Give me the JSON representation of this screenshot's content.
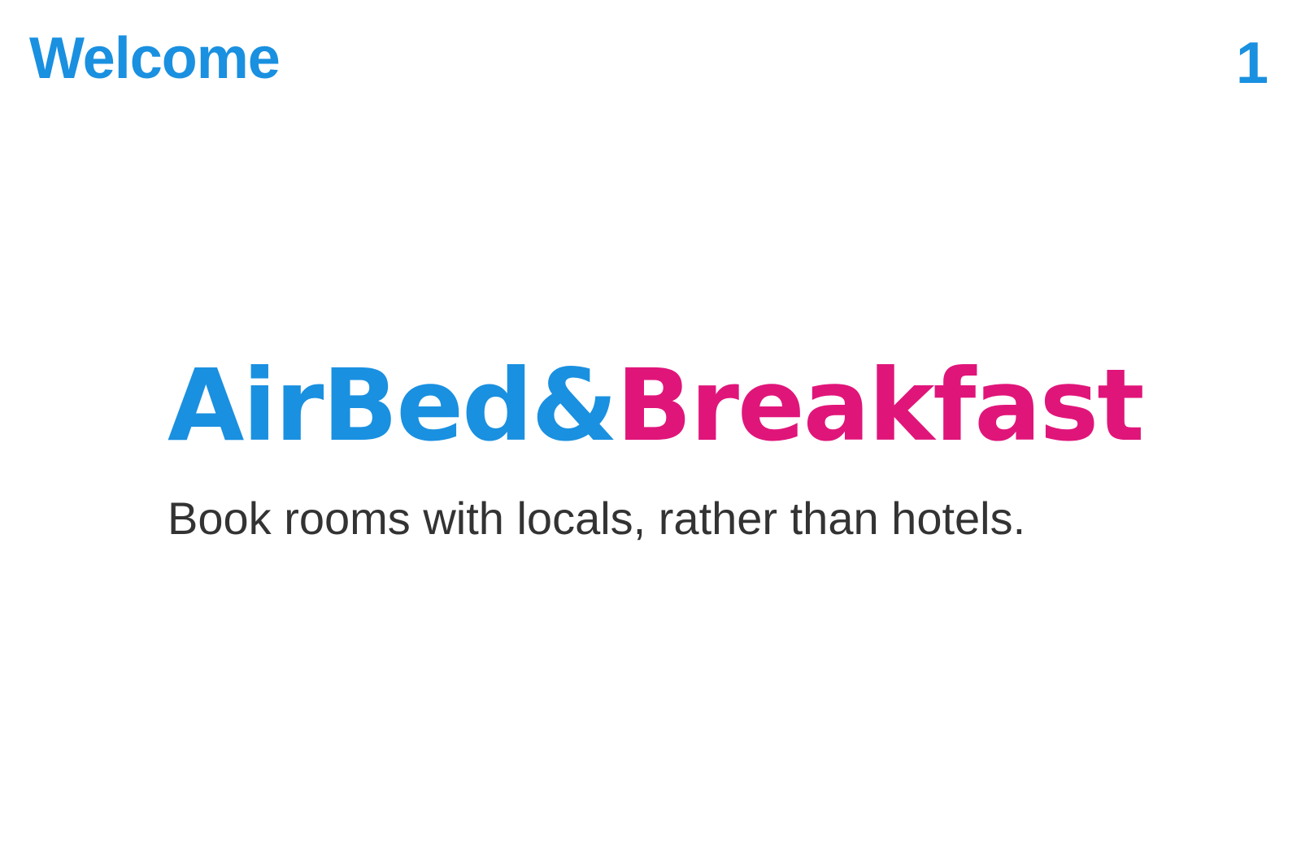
{
  "header": {
    "title": "Welcome",
    "slide_number": "1"
  },
  "logo": {
    "part_1": "AirBed&",
    "part_2": "Breakfast"
  },
  "tagline": "Book rooms with locals, rather than hotels.",
  "colors": {
    "accent_blue": "#1a90e0",
    "accent_pink": "#e0157a",
    "body_text": "#333333",
    "background": "#ffffff"
  }
}
